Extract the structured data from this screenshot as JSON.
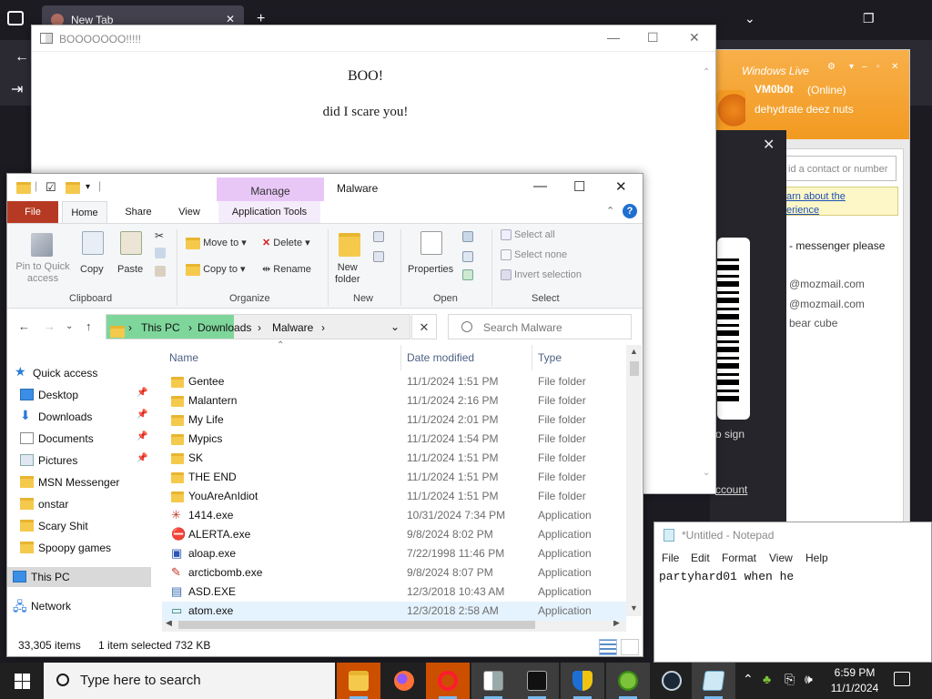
{
  "browser": {
    "tab_title": "New Tab"
  },
  "msn": {
    "brand": "Windows Live",
    "nickname": "VM0b0t",
    "status": "(Online)",
    "personal_message": "dehydrate deez nuts",
    "search_placeholder": "id a contact or number",
    "tip_line1": "arn about the",
    "tip_line2": "erience",
    "lines": [
      "- messenger please",
      "@mozmail.com",
      "@mozmail.com",
      "bear cube"
    ]
  },
  "popup": {
    "sign_text": "o sign",
    "account_text": "ccount"
  },
  "boo_window": {
    "title": "BOOOOOOO!!!!!",
    "heading": "BOO!",
    "text": "did I scare you!"
  },
  "explorer": {
    "manage_label": "Manage",
    "window_title": "Malware",
    "tabs": {
      "file": "File",
      "home": "Home",
      "share": "Share",
      "view": "View",
      "app_tools": "Application Tools"
    },
    "ribbon": {
      "pin": [
        "Pin to Quick",
        "access"
      ],
      "copy": "Copy",
      "paste": "Paste",
      "clipboard_group": "Clipboard",
      "move_to": "Move to",
      "copy_to": "Copy to",
      "delete": "Delete",
      "rename": "Rename",
      "organize_group": "Organize",
      "new_folder": [
        "New",
        "folder"
      ],
      "new_group": "New",
      "properties": "Properties",
      "open_group": "Open",
      "select_all": "Select all",
      "select_none": "Select none",
      "invert_selection": "Invert selection",
      "select_group": "Select"
    },
    "path": [
      "This PC",
      "Downloads",
      "Malware"
    ],
    "search_placeholder": "Search Malware",
    "columns": {
      "name": "Name",
      "date": "Date modified",
      "type": "Type"
    },
    "nav": [
      {
        "label": "Quick access",
        "pinned": false
      },
      {
        "label": "Desktop",
        "pinned": true
      },
      {
        "label": "Downloads",
        "pinned": true
      },
      {
        "label": "Documents",
        "pinned": true
      },
      {
        "label": "Pictures",
        "pinned": true
      },
      {
        "label": "MSN Messenger",
        "pinned": false
      },
      {
        "label": "onstar",
        "pinned": false
      },
      {
        "label": "Scary Shit",
        "pinned": false
      },
      {
        "label": "Spoopy games",
        "pinned": false
      },
      {
        "label": "This PC",
        "pinned": false
      },
      {
        "label": "Network",
        "pinned": false
      }
    ],
    "files": [
      {
        "name": "Gentee",
        "date": "11/1/2024 1:51 PM",
        "type": "File folder"
      },
      {
        "name": "Malantern",
        "date": "11/1/2024 2:16 PM",
        "type": "File folder"
      },
      {
        "name": "My Life",
        "date": "11/1/2024 2:01 PM",
        "type": "File folder"
      },
      {
        "name": "Mypics",
        "date": "11/1/2024 1:54 PM",
        "type": "File folder"
      },
      {
        "name": "SK",
        "date": "11/1/2024 1:51 PM",
        "type": "File folder"
      },
      {
        "name": "THE END",
        "date": "11/1/2024 1:51 PM",
        "type": "File folder"
      },
      {
        "name": "YouAreAnIdiot",
        "date": "11/1/2024 1:51 PM",
        "type": "File folder"
      },
      {
        "name": "1414.exe",
        "date": "10/31/2024 7:34 PM",
        "type": "Application"
      },
      {
        "name": "ALERTA.exe",
        "date": "9/8/2024 8:02 PM",
        "type": "Application"
      },
      {
        "name": "aloap.exe",
        "date": "7/22/1998 11:46 PM",
        "type": "Application"
      },
      {
        "name": "arcticbomb.exe",
        "date": "9/8/2024 8:07 PM",
        "type": "Application"
      },
      {
        "name": "ASD.EXE",
        "date": "12/3/2018 10:43 AM",
        "type": "Application"
      },
      {
        "name": "atom.exe",
        "date": "12/3/2018 2:58 AM",
        "type": "Application"
      }
    ],
    "status_items": "33,305 items",
    "status_selected": "1 item selected",
    "status_size": "732 KB"
  },
  "notepad": {
    "title": "*Untitled - Notepad",
    "menu": [
      "File",
      "Edit",
      "Format",
      "View",
      "Help"
    ],
    "text": "partyhard01 when he"
  },
  "taskbar": {
    "search_placeholder": "Type here to search",
    "time": "6:59 PM",
    "date": "11/1/2024"
  },
  "colors": {
    "file_tab": "#b63a23",
    "manage_tab": "#e8c7f7",
    "address_highlight": "#7ed69b",
    "msn_orange": "#f29a21",
    "taskbar": "#202020"
  }
}
